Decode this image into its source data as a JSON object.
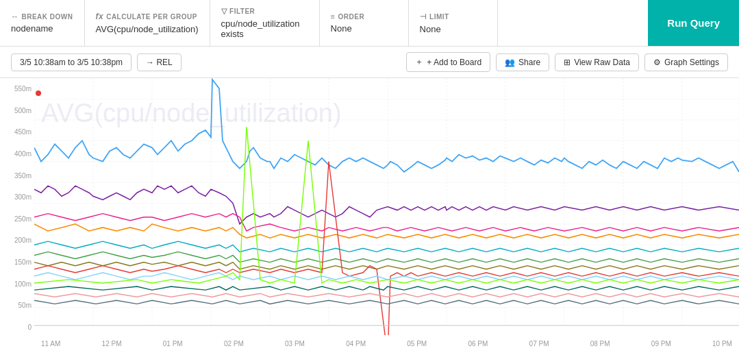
{
  "topbar": {
    "breakdown": {
      "label": "BREAK DOWN",
      "icon": "↔",
      "value": "nodename"
    },
    "calculate": {
      "label": "CALCULATE PER GROUP",
      "icon": "fx",
      "value": "AVG(cpu/node_utilization)"
    },
    "filter": {
      "label": "FILTER",
      "icon": "▽",
      "value": "cpu/node_utilization\nexists"
    },
    "order": {
      "label": "ORDER",
      "icon": "≡",
      "value": "None"
    },
    "limit": {
      "label": "LIMIT",
      "icon": "⊣",
      "value": "None"
    },
    "run_query": "Run Query"
  },
  "toolbar": {
    "date_range": "3/5 10:38am to 3/5 10:38pm",
    "rel_label": "→ REL",
    "add_to_board": "+ Add to Board",
    "share": "Share",
    "view_raw_data": "View Raw Data",
    "graph_settings": "Graph Settings"
  },
  "chart": {
    "watermark": "AVG(cpu/node_utilization)",
    "y_labels": [
      "550m",
      "500m",
      "450m",
      "400m",
      "350m",
      "300m",
      "250m",
      "200m",
      "150m",
      "100m",
      "50m",
      "0"
    ],
    "x_labels": [
      "11 AM",
      "12 PM",
      "01 PM",
      "02 PM",
      "03 PM",
      "04 PM",
      "05 PM",
      "06 PM",
      "07 PM",
      "08 PM",
      "09 PM",
      "10 PM"
    ]
  }
}
